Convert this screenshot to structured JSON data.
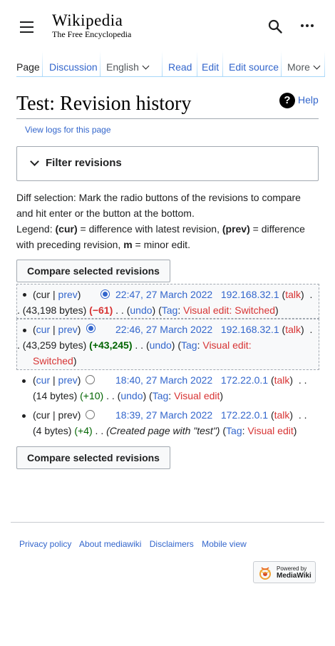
{
  "header": {
    "wordmark": "Wikipedia",
    "tagline": "The Free Encyclopedia",
    "menu_icon": "hamburger-menu-icon",
    "search_icon": "search-icon",
    "more_icon": "ellipsis-icon"
  },
  "tabs": {
    "page": "Page",
    "discussion": "Discussion",
    "language": "English",
    "read": "Read",
    "edit": "Edit",
    "edit_source": "Edit source",
    "more": "More"
  },
  "title": "Test: Revision history",
  "help": "Help",
  "view_logs": "View logs for this page",
  "filter": {
    "label": "Filter revisions"
  },
  "intro": {
    "line1": "Diff selection: Mark the radio buttons of the revisions to compare",
    "line2": "and hit enter or the button at the bottom.",
    "legend_prefix": "Legend: ",
    "legend_cur": "(cur)",
    "legend_cur_text": " = difference with latest revision, ",
    "legend_prev": "(prev)",
    "legend_prev_text": " = difference",
    "line4_prefix": "with preceding revision, ",
    "legend_m": "m",
    "legend_m_text": " = minor edit."
  },
  "compare_button": "Compare selected revisions",
  "revisions": [
    {
      "cur": "cur",
      "prev": "prev",
      "date": "22:47, 27 March 2022",
      "user": "192.168.32.1",
      "talk": "talk",
      "size": "(43,198 bytes)",
      "diff": "(−61)",
      "undo": "undo",
      "tag_label": "Tag",
      "tag": "Visual edit: Switched"
    },
    {
      "cur": "cur",
      "prev": "prev",
      "date": "22:46, 27 March 2022",
      "user": "192.168.32.1",
      "talk": "talk",
      "size": "(43,259 bytes)",
      "diff": "(+43,245)",
      "undo": "undo",
      "tag_label": "Tag",
      "tag_part1": "Visual edit:",
      "tag_part2": "Switched"
    },
    {
      "cur": "cur",
      "prev": "prev",
      "date": "18:40, 27 March 2022",
      "user": "172.22.0.1",
      "talk": "talk",
      "size": "(14 bytes)",
      "diff": "(+10)",
      "undo": "undo",
      "tag_label": "Tag",
      "tag": "Visual edit"
    },
    {
      "cur": "cur",
      "prev": "prev",
      "date": "18:39, 27 March 2022",
      "user": "172.22.0.1",
      "talk": "talk",
      "size": "(4 bytes)",
      "diff": "(+4)",
      "summary": "(Created page with \"test\")",
      "tag_label": "Tag",
      "tag": "Visual edit"
    }
  ],
  "footer": {
    "privacy": "Privacy policy",
    "about": "About mediawiki",
    "disclaimers": "Disclaimers",
    "mobile": "Mobile view",
    "powered_small": "Powered by",
    "powered_big": "MediaWiki"
  }
}
